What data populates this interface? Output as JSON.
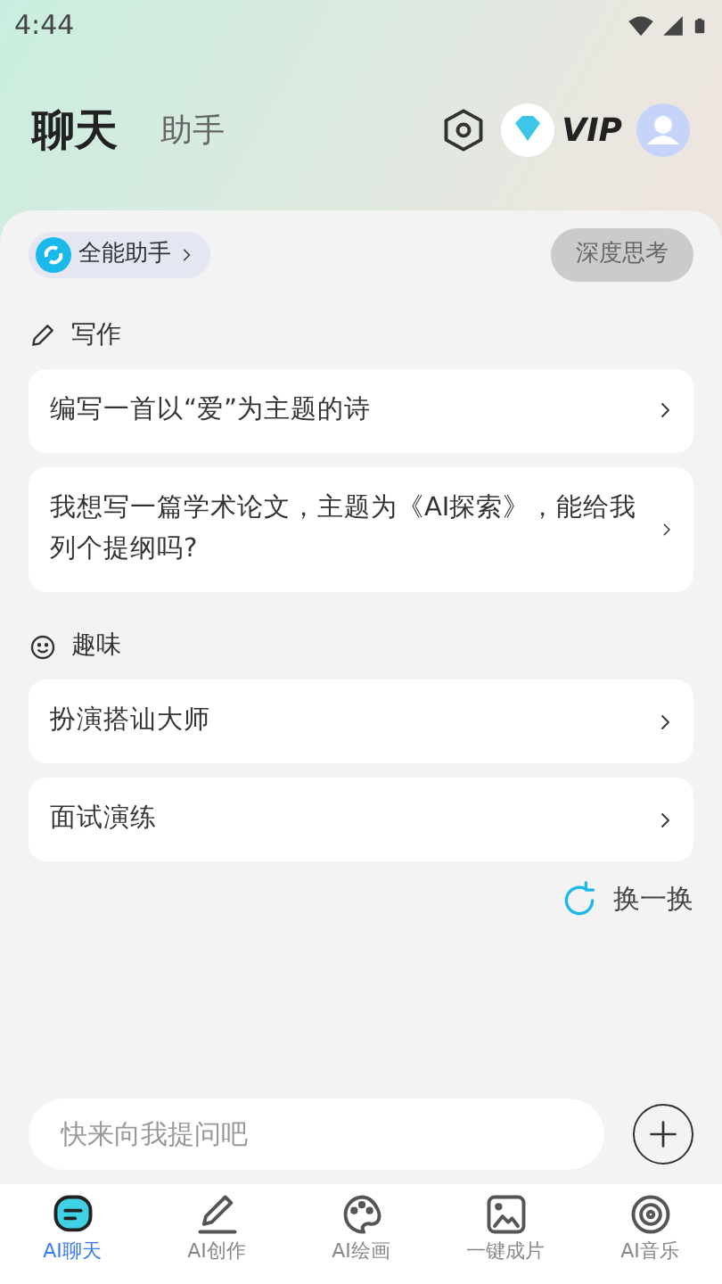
{
  "status_bar": {
    "time": "4:44"
  },
  "header_tabs": [
    {
      "label": "聊天",
      "selected": true
    },
    {
      "label": "助手",
      "selected": false
    }
  ],
  "vip": {
    "label": "VIP"
  },
  "assistant_chip": {
    "label": "全能助手"
  },
  "deep_think": {
    "label": "深度思考",
    "on": false
  },
  "sections": [
    {
      "kind": "write",
      "title": "写作",
      "prompts": [
        "编写一首以“爱”为主题的诗",
        "我想写一篇学术论文，主题为《AI探索》，能给我列个提纲吗?"
      ]
    },
    {
      "kind": "fun",
      "title": "趣味",
      "prompts": [
        "扮演搭讪大师",
        "面试演练"
      ]
    }
  ],
  "refresh": {
    "label": "换一换"
  },
  "input": {
    "placeholder": "快来向我提问吧"
  },
  "bottom_nav": [
    {
      "kind": "chat",
      "label": "AI聊天",
      "selected": true
    },
    {
      "kind": "create",
      "label": "AI创作",
      "selected": false
    },
    {
      "kind": "paint",
      "label": "AI绘画",
      "selected": false
    },
    {
      "kind": "photo",
      "label": "一键成片",
      "selected": false
    },
    {
      "kind": "music",
      "label": "AI音乐",
      "selected": false
    }
  ]
}
